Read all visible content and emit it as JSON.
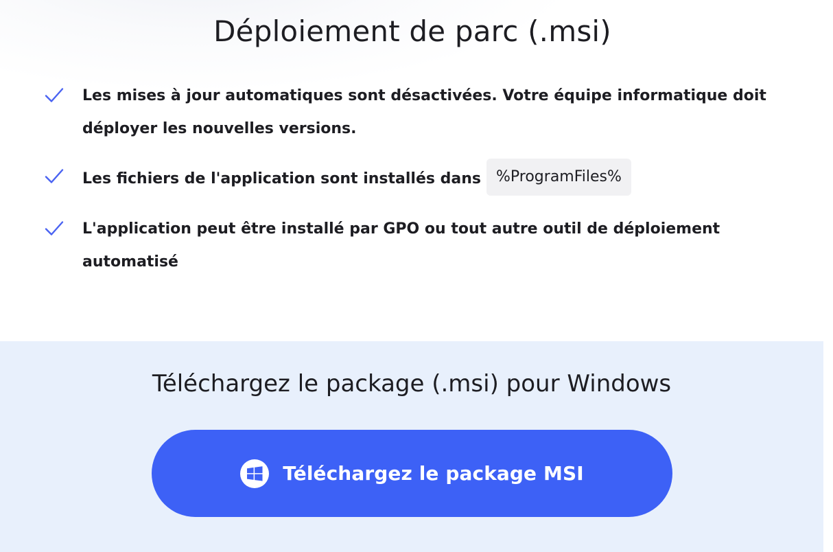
{
  "header": {
    "title": "Déploiement de parc (.msi)"
  },
  "features": [
    {
      "icon": "check-icon",
      "text": "Les mises à jour automatiques sont désactivées. Votre équipe informatique doit déployer les nouvelles versions."
    },
    {
      "icon": "check-icon",
      "text": "Les fichiers de l'application sont installés dans",
      "code": "%ProgramFiles%"
    },
    {
      "icon": "check-icon",
      "text": "L'application peut être installé par GPO ou tout autre outil de déploiement automatisé"
    }
  ],
  "download": {
    "title": "Téléchargez le package (.msi) pour Windows",
    "button_label": "Téléchargez le package MSI",
    "button_icon": "windows-logo-icon"
  },
  "colors": {
    "accent": "#3d61f6",
    "check": "#4a63f2",
    "panel_background": "#e8f0fc",
    "code_background": "#f1f1f3",
    "text": "#1d1d22"
  }
}
